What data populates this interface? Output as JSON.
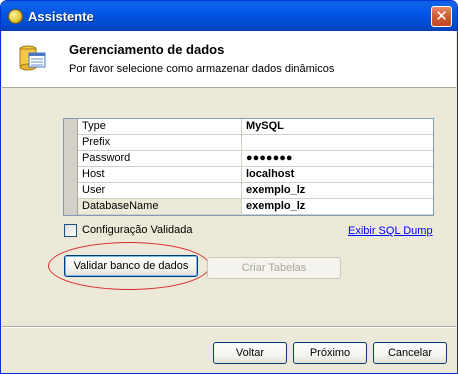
{
  "window": {
    "title": "Assistente",
    "close_label": "✕"
  },
  "header": {
    "title": "Gerenciamento de dados",
    "subtitle": "Por favor selecione como armazenar dados dinâmicos"
  },
  "properties": [
    {
      "key": "Type",
      "value": "MySQL"
    },
    {
      "key": "Prefix",
      "value": ""
    },
    {
      "key": "Password",
      "value": "●●●●●●●"
    },
    {
      "key": "Host",
      "value": "localhost"
    },
    {
      "key": "User",
      "value": "exemplo_lz"
    },
    {
      "key": "DatabaseName",
      "value": "exemplo_lz"
    }
  ],
  "options": {
    "validated_label": "Configuração Validada",
    "validated_checked": false,
    "sql_dump_link": "Exibir SQL Dump"
  },
  "actions": {
    "validate_label": "Validar banco de dados",
    "create_tables_label": "Criar Tabelas"
  },
  "footer": {
    "back_label": "Voltar",
    "next_label": "Próximo",
    "cancel_label": "Cancelar"
  },
  "colors": {
    "highlight": "#d82a2a",
    "title_bar": "#0054e3",
    "link": "#0000ff"
  }
}
